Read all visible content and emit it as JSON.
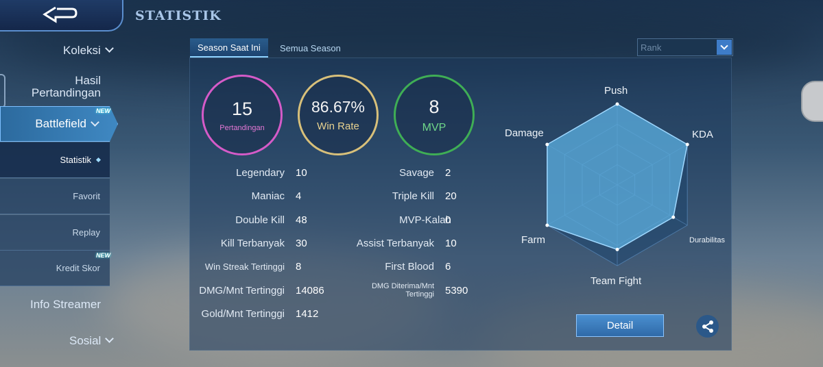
{
  "header": {
    "title": "STATISTIK"
  },
  "sidebar": {
    "koleksi": "Koleksi",
    "hasil_line1": "Hasil",
    "hasil_line2": "Pertandingan",
    "battlefield": "Battlefield",
    "battlefield_badge": "NEW",
    "sub_items": [
      "Statistik",
      "Favorit",
      "Replay",
      "Kredit Skor"
    ],
    "kredit_badge": "NEW",
    "info_streamer": "Info Streamer",
    "sosial": "Sosial"
  },
  "tabs": {
    "current": "Season Saat Ini",
    "all": "Semua Season"
  },
  "filter": {
    "selected": "Rank"
  },
  "summary": {
    "matches": {
      "value": "15",
      "label": "Pertandingan"
    },
    "winrate": {
      "value": "86.67%",
      "label": "Win Rate"
    },
    "mvp": {
      "value": "8",
      "label": "MVP"
    }
  },
  "stats_left": [
    {
      "label": "Legendary",
      "value": "10"
    },
    {
      "label": "Maniac",
      "value": "4"
    },
    {
      "label": "Double Kill",
      "value": "48"
    },
    {
      "label": "Kill Terbanyak",
      "value": "30"
    },
    {
      "label": "Win Streak Tertinggi",
      "value": "8"
    },
    {
      "label": "DMG/Mnt Tertinggi",
      "value": "14086"
    },
    {
      "label": "Gold/Mnt Tertinggi",
      "value": "1412"
    }
  ],
  "stats_right": [
    {
      "label": "Savage",
      "value": "2"
    },
    {
      "label": "Triple Kill",
      "value": "20"
    },
    {
      "label": "MVP-Kalah",
      "value": "0"
    },
    {
      "label": "Assist Terbanyak",
      "value": "10"
    },
    {
      "label": "First Blood",
      "value": "6"
    },
    {
      "label": "DMG Diterima/Mnt Tertinggi",
      "label_line1": "DMG Diterima/Mnt",
      "label_line2": "Tertinggi",
      "value": "5390"
    }
  ],
  "radar": {
    "axes": [
      "Push",
      "KDA",
      "Durabilitas",
      "Team Fight",
      "Farm",
      "Damage"
    ],
    "values": [
      1.0,
      1.0,
      0.8,
      0.8,
      1.0,
      1.0
    ],
    "colors": {
      "fill": "#5aa9d8",
      "outline": "#9fd8ff"
    }
  },
  "buttons": {
    "detail": "Detail"
  },
  "icons": {
    "back": "back-arrow-icon",
    "share": "share-icon"
  }
}
